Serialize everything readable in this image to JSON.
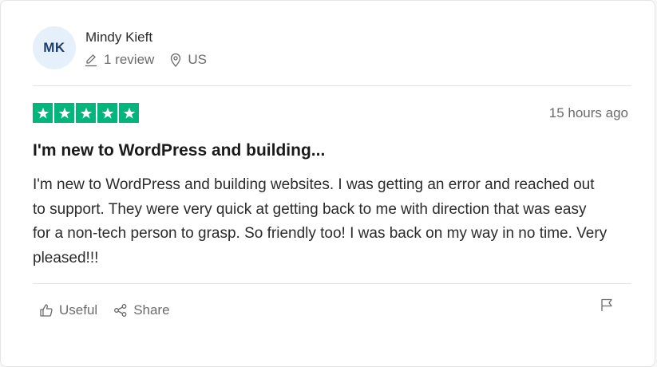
{
  "reviewer": {
    "initials": "MK",
    "name": "Mindy Kieft",
    "review_count": "1 review",
    "country": "US"
  },
  "review": {
    "rating": 5,
    "max_rating": 5,
    "date": "15 hours ago",
    "title": "I'm new to WordPress and building...",
    "body": "I'm new to WordPress and building websites. I was getting an error and reached out to support. They were very quick at getting back to me with direction that was easy for a non-tech person to grasp. So friendly too! I was back on my way in no time. Very pleased!!!"
  },
  "actions": {
    "useful_label": "Useful",
    "share_label": "Share"
  },
  "colors": {
    "star_green": "#00b67a",
    "avatar_bg": "#e5f0fb",
    "avatar_text": "#1c3f6e"
  },
  "icons": {
    "review_count": "pencil-icon",
    "country": "location-pin-icon",
    "useful": "thumbs-up-icon",
    "share": "share-icon",
    "report": "flag-icon",
    "star": "star-icon"
  }
}
